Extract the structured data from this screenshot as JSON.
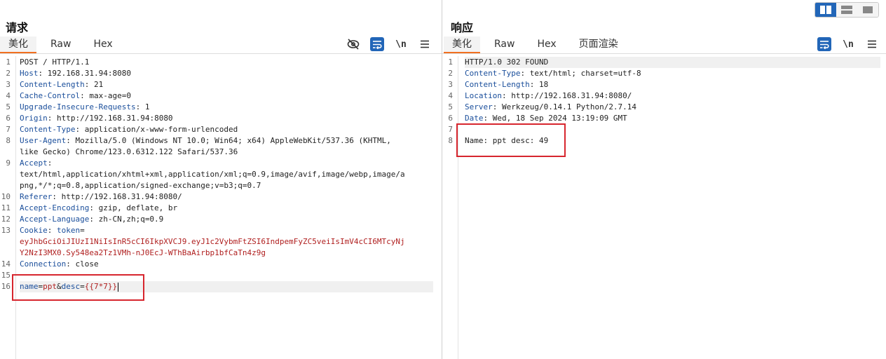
{
  "layout_buttons": {
    "icons": [
      "split-columns-icon",
      "split-rows-icon",
      "single-pane-icon"
    ],
    "active": 0
  },
  "request": {
    "title": "请求",
    "tabs": [
      "美化",
      "Raw",
      "Hex"
    ],
    "active_tab": 0,
    "tools": {
      "wrap_label": "\\n"
    },
    "lines": [
      {
        "n": "1",
        "parts": [
          {
            "t": "POST / HTTP/1.1",
            "c": "v"
          }
        ]
      },
      {
        "n": "2",
        "parts": [
          {
            "t": "Host",
            "c": "k"
          },
          {
            "t": ": 192.168.31.94:8080",
            "c": "v"
          }
        ]
      },
      {
        "n": "3",
        "parts": [
          {
            "t": "Content-Length",
            "c": "k"
          },
          {
            "t": ": 21",
            "c": "v"
          }
        ]
      },
      {
        "n": "4",
        "parts": [
          {
            "t": "Cache-Control",
            "c": "k"
          },
          {
            "t": ": max-age=0",
            "c": "v"
          }
        ]
      },
      {
        "n": "5",
        "parts": [
          {
            "t": "Upgrade-Insecure-Requests",
            "c": "k"
          },
          {
            "t": ": 1",
            "c": "v"
          }
        ]
      },
      {
        "n": "6",
        "parts": [
          {
            "t": "Origin",
            "c": "k"
          },
          {
            "t": ": http://192.168.31.94:8080",
            "c": "v"
          }
        ]
      },
      {
        "n": "7",
        "parts": [
          {
            "t": "Content-Type",
            "c": "k"
          },
          {
            "t": ": application/x-www-form-urlencoded",
            "c": "v"
          }
        ]
      },
      {
        "n": "8",
        "parts": [
          {
            "t": "User-Agent",
            "c": "k"
          },
          {
            "t": ": Mozilla/5.0 (Windows NT 10.0; Win64; x64) AppleWebKit/537.36 (KHTML,",
            "c": "v"
          }
        ]
      },
      {
        "n": "",
        "parts": [
          {
            "t": "like Gecko) Chrome/123.0.6312.122 Safari/537.36",
            "c": "v"
          }
        ]
      },
      {
        "n": "9",
        "parts": [
          {
            "t": "Accept",
            "c": "k"
          },
          {
            "t": ":",
            "c": "v"
          }
        ]
      },
      {
        "n": "",
        "parts": [
          {
            "t": "text/html,application/xhtml+xml,application/xml;q=0.9,image/avif,image/webp,image/a",
            "c": "v"
          }
        ]
      },
      {
        "n": "",
        "parts": [
          {
            "t": "png,*/*;q=0.8,application/signed-exchange;v=b3;q=0.7",
            "c": "v"
          }
        ]
      },
      {
        "n": "10",
        "parts": [
          {
            "t": "Referer",
            "c": "k"
          },
          {
            "t": ": http://192.168.31.94:8080/",
            "c": "v"
          }
        ]
      },
      {
        "n": "11",
        "parts": [
          {
            "t": "Accept-Encoding",
            "c": "k"
          },
          {
            "t": ": gzip, deflate, br",
            "c": "v"
          }
        ]
      },
      {
        "n": "12",
        "parts": [
          {
            "t": "Accept-Language",
            "c": "k"
          },
          {
            "t": ": zh-CN,zh;q=0.9",
            "c": "v"
          }
        ]
      },
      {
        "n": "13",
        "parts": [
          {
            "t": "Cookie",
            "c": "k"
          },
          {
            "t": ": ",
            "c": "v"
          },
          {
            "t": "token",
            "c": "k"
          },
          {
            "t": "=",
            "c": "v"
          }
        ]
      },
      {
        "n": "",
        "parts": [
          {
            "t": "eyJhbGciOiJIUzI1NiIsInR5cCI6IkpXVCJ9.eyJ1c2VybmFtZSI6IndpemFyZC5veiIsImV4cCI6MTcyNj",
            "c": "ck"
          }
        ]
      },
      {
        "n": "",
        "parts": [
          {
            "t": "Y2NzI3MX0.Sy548ea2Tz1VMh-nJ0EcJ-WThBaAirbp1bfCaTn4z9g",
            "c": "ck"
          }
        ]
      },
      {
        "n": "14",
        "parts": [
          {
            "t": "Connection",
            "c": "k"
          },
          {
            "t": ": close",
            "c": "v"
          }
        ]
      },
      {
        "n": "15",
        "parts": []
      },
      {
        "n": "16",
        "parts": [
          {
            "t": "name",
            "c": "pk"
          },
          {
            "t": "=",
            "c": "v"
          },
          {
            "t": "ppt",
            "c": "pv"
          },
          {
            "t": "&",
            "c": "v"
          },
          {
            "t": "desc",
            "c": "pk"
          },
          {
            "t": "=",
            "c": "v"
          },
          {
            "t": "{{7*7}}",
            "c": "pv"
          }
        ],
        "current": true,
        "caret": true
      }
    ]
  },
  "response": {
    "title": "响应",
    "tabs": [
      "美化",
      "Raw",
      "Hex",
      "页面渲染"
    ],
    "active_tab": 0,
    "tools": {
      "wrap_label": "\\n"
    },
    "lines": [
      {
        "n": "1",
        "parts": [
          {
            "t": "HTTP/1.0 302 FOUND",
            "c": "v"
          }
        ],
        "current": true
      },
      {
        "n": "2",
        "parts": [
          {
            "t": "Content-Type",
            "c": "k"
          },
          {
            "t": ": text/html; charset=utf-8",
            "c": "v"
          }
        ]
      },
      {
        "n": "3",
        "parts": [
          {
            "t": "Content-Length",
            "c": "k"
          },
          {
            "t": ": 18",
            "c": "v"
          }
        ]
      },
      {
        "n": "4",
        "parts": [
          {
            "t": "Location",
            "c": "k"
          },
          {
            "t": ": http://192.168.31.94:8080/",
            "c": "v"
          }
        ]
      },
      {
        "n": "5",
        "parts": [
          {
            "t": "Server",
            "c": "k"
          },
          {
            "t": ": Werkzeug/0.14.1 Python/2.7.14",
            "c": "v"
          }
        ]
      },
      {
        "n": "6",
        "parts": [
          {
            "t": "Date",
            "c": "k"
          },
          {
            "t": ": Wed, 18 Sep 2024 13:19:09 GMT",
            "c": "v"
          }
        ]
      },
      {
        "n": "7",
        "parts": []
      },
      {
        "n": "8",
        "parts": [
          {
            "t": "Name: ppt desc: 49",
            "c": "v"
          }
        ]
      }
    ]
  }
}
